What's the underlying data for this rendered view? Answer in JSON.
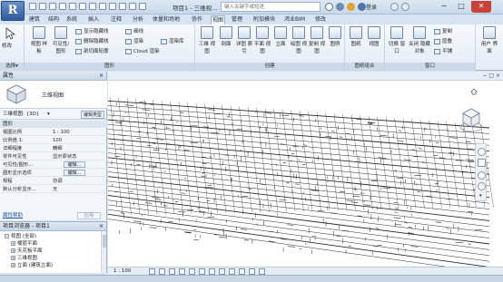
{
  "app": {
    "logo_letter": "R"
  },
  "titlebar": {
    "doc_title": "项目1 - 三维视...",
    "search_placeholder": "键入关键字或短语",
    "user_name": "登录"
  },
  "tabs": [
    "建筑",
    "结构",
    "系统",
    "插入",
    "注释",
    "分析",
    "体量和场地",
    "协作",
    "视图",
    "管理",
    "附加模块",
    "鸿业BIM",
    "修改"
  ],
  "active_tab_index": 8,
  "ribbon": {
    "groups": [
      {
        "label": "选择",
        "dropdown": "▾"
      },
      {
        "label": "图形"
      },
      {
        "label": "创建"
      },
      {
        "label": "图纸组合"
      },
      {
        "label": "窗口"
      }
    ],
    "modify_label": "修改",
    "graphics": {
      "big": [
        {
          "label": "视图\n样板"
        },
        {
          "label": "可见性/\n图形"
        }
      ],
      "small": [
        "显示隐藏线",
        "删除隐藏线",
        "剖切面轮廓",
        "细线",
        "渲染",
        "Cloud 渲染",
        "渲染库"
      ]
    },
    "create": {
      "big": [
        "三维\n视图",
        "剖面",
        "详图\n索引",
        "平面\n视图",
        "立面",
        "绘图\n视图",
        "复制\n视图",
        "图例",
        "明细表"
      ]
    },
    "sheet": {
      "big": [
        "图纸",
        "视图",
        "标题栏"
      ]
    },
    "window": {
      "big": [
        "切换\n窗口",
        "关闭\n隐藏对象",
        "复制",
        "层叠",
        "平铺",
        "用户\n界面"
      ]
    }
  },
  "properties": {
    "panel_title": "属性",
    "type_name": "三维视图",
    "filter_value": "三维视图: {3D}",
    "edit_type_label": "编辑类型",
    "section_label": "图形",
    "rows": [
      {
        "key": "视图比例",
        "value": "1 : 100"
      },
      {
        "key": "比例值 1:",
        "value": "100"
      },
      {
        "key": "详细程度",
        "value": "精细"
      },
      {
        "key": "零件可见性",
        "value": "显示原状态"
      },
      {
        "key": "可见性/图形...",
        "button": "编辑..."
      },
      {
        "key": "图形显示选项",
        "button": "编辑..."
      },
      {
        "key": "规程",
        "value": "协调"
      },
      {
        "key": "默认分析显示...",
        "value": "无"
      }
    ],
    "help_link": "属性帮助",
    "apply_label": "应用"
  },
  "browser": {
    "title": "项目浏览器 - 项目1",
    "items": [
      {
        "text": "视图 (全部)",
        "toggle": "−",
        "indent": 0
      },
      {
        "text": "楼层平面",
        "toggle": "+",
        "indent": 1
      },
      {
        "text": "天花板平面",
        "toggle": "+",
        "indent": 1
      },
      {
        "text": "三维视图",
        "toggle": "+",
        "indent": 1
      },
      {
        "text": "立面 (建筑立面)",
        "toggle": "+",
        "indent": 1
      }
    ]
  },
  "view": {
    "scale_label": "1 : 100",
    "win_controls": [
      "−",
      "□",
      "×"
    ]
  },
  "colors": {
    "ribbon_bg": "#e9f0f8",
    "active_tab": "#f3f7fc",
    "close_red": "#c7433a",
    "link_blue": "#1d56a8"
  },
  "icons": [
    "app-menu-icon",
    "save-icon",
    "undo-icon",
    "redo-icon",
    "search-icon",
    "user-icon",
    "help-icon",
    "viewcube-icon",
    "steering-wheel-icon",
    "zoom-icon",
    "pan-icon"
  ]
}
